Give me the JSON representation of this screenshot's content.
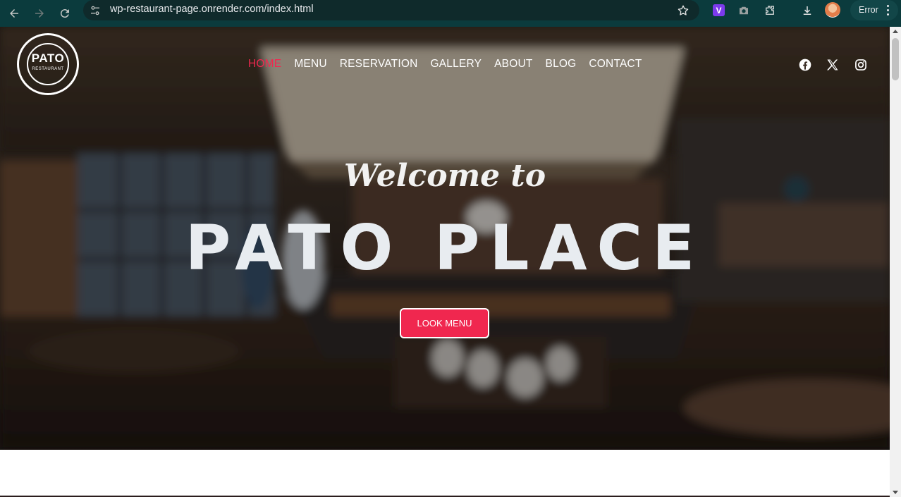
{
  "browser": {
    "url": "wp-restaurant-page.onrender.com/index.html",
    "error_label": "Error",
    "extension_v_label": "V",
    "icons": [
      "back-icon",
      "forward-icon",
      "reload-icon",
      "site-settings-icon",
      "bookmark-star-icon",
      "extension-v-icon",
      "screenshot-camera-icon",
      "extensions-puzzle-icon",
      "download-icon",
      "profile-avatar",
      "menu-dots-icon"
    ]
  },
  "site": {
    "logo": {
      "brand": "PATO",
      "sub": "RESTAURANT"
    },
    "nav": [
      {
        "label": "HOME",
        "active": true
      },
      {
        "label": "MENU",
        "active": false
      },
      {
        "label": "RESERVATION",
        "active": false
      },
      {
        "label": "GALLERY",
        "active": false
      },
      {
        "label": "ABOUT",
        "active": false
      },
      {
        "label": "BLOG",
        "active": false
      },
      {
        "label": "CONTACT",
        "active": false
      }
    ],
    "social": [
      "facebook-icon",
      "x-icon",
      "instagram-icon"
    ],
    "hero": {
      "welcome": "Welcome to",
      "title": "PATO PLACE",
      "cta_label": "LOOK MENU"
    }
  },
  "colors": {
    "accent": "#f0274f",
    "chrome": "#0b3b3d",
    "omnibox": "#0f2a2b",
    "text_light": "#ffffff"
  }
}
